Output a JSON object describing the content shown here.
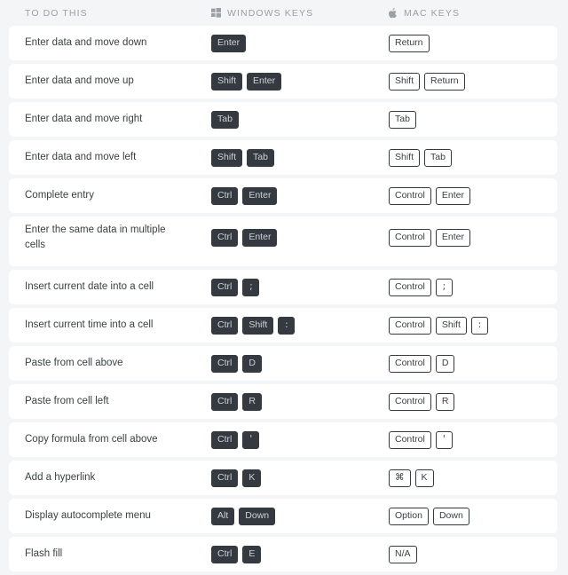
{
  "header": {
    "columns": [
      {
        "label": "TO DO THIS",
        "icon": null
      },
      {
        "label": "WINDOWS KEYS",
        "icon": "windows-logo-icon"
      },
      {
        "label": "MAC KEYS",
        "icon": "apple-logo-icon"
      }
    ]
  },
  "colors": {
    "page_background": "#f4f5f6",
    "row_background": "#ffffff",
    "windows_key_background": "#343a40",
    "windows_key_text": "#ced2d6",
    "mac_key_border": "#343a40",
    "header_text": "#9aa0a6",
    "body_text": "#3c4043"
  },
  "rows": [
    {
      "task": "Enter data and move down",
      "windows": [
        "Enter"
      ],
      "mac": [
        "Return"
      ],
      "two_line": false
    },
    {
      "task": "Enter data and move up",
      "windows": [
        "Shift",
        "Enter"
      ],
      "mac": [
        "Shift",
        "Return"
      ],
      "two_line": false
    },
    {
      "task": "Enter data and move right",
      "windows": [
        "Tab"
      ],
      "mac": [
        "Tab"
      ],
      "two_line": false
    },
    {
      "task": "Enter data and move left",
      "windows": [
        "Shift",
        "Tab"
      ],
      "mac": [
        "Shift",
        "Tab"
      ],
      "two_line": false
    },
    {
      "task": "Complete entry",
      "windows": [
        "Ctrl",
        "Enter"
      ],
      "mac": [
        "Control",
        "Enter"
      ],
      "two_line": false
    },
    {
      "task": "Enter the same data in multiple cells",
      "windows": [
        "Ctrl",
        "Enter"
      ],
      "mac": [
        "Control",
        "Enter"
      ],
      "two_line": true
    },
    {
      "task": "Insert current date into a cell",
      "windows": [
        "Ctrl",
        ";"
      ],
      "mac": [
        "Control",
        ";"
      ],
      "two_line": false
    },
    {
      "task": "Insert current time into a cell",
      "windows": [
        "Ctrl",
        "Shift",
        ":"
      ],
      "mac": [
        "Control",
        "Shift",
        ":"
      ],
      "two_line": false
    },
    {
      "task": "Paste from cell above",
      "windows": [
        "Ctrl",
        "D"
      ],
      "mac": [
        "Control",
        "D"
      ],
      "two_line": false
    },
    {
      "task": "Paste from cell left",
      "windows": [
        "Ctrl",
        "R"
      ],
      "mac": [
        "Control",
        "R"
      ],
      "two_line": false
    },
    {
      "task": "Copy formula from cell above",
      "windows": [
        "Ctrl",
        "'"
      ],
      "mac": [
        "Control",
        "'"
      ],
      "two_line": false
    },
    {
      "task": "Add a hyperlink",
      "windows": [
        "Ctrl",
        "K"
      ],
      "mac": [
        "⌘",
        "K"
      ],
      "two_line": false
    },
    {
      "task": "Display autocomplete menu",
      "windows": [
        "Alt",
        "Down"
      ],
      "mac": [
        "Option",
        "Down"
      ],
      "two_line": false
    },
    {
      "task": "Flash fill",
      "windows": [
        "Ctrl",
        "E"
      ],
      "mac": [
        "N/A"
      ],
      "two_line": false
    }
  ]
}
